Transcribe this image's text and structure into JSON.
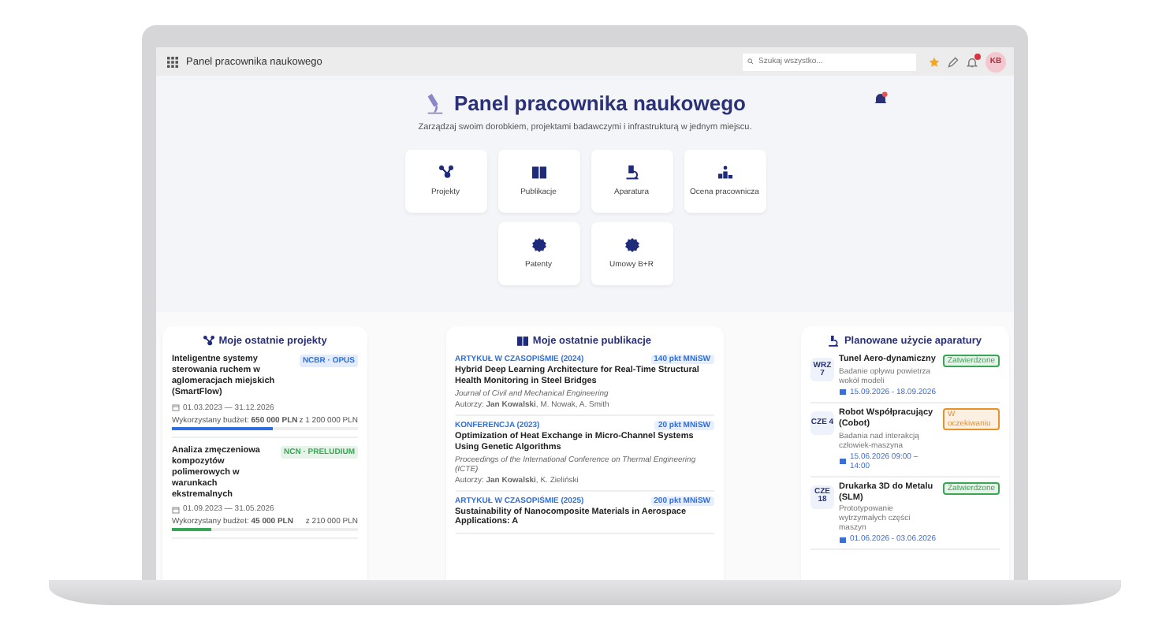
{
  "top_bar": {
    "title": "Panel pracownika naukowego",
    "search": {
      "placeholder": "Szukaj wszystko..."
    },
    "avatar": "KB"
  },
  "hero": {
    "title": "Panel pracownika naukowego",
    "subtitle": "Zarządzaj swoim dorobkiem, projektami badawczymi i infrastrukturą w jednym miejscu."
  },
  "tiles": [
    {
      "label": "Projekty",
      "kind": "network"
    },
    {
      "label": "Publikacje",
      "kind": "book"
    },
    {
      "label": "Aparatura",
      "kind": "microscope"
    },
    {
      "label": "Ocena pracownicza",
      "kind": "podium"
    },
    {
      "label": "Patenty",
      "kind": "seal"
    },
    {
      "label": "Umowy B+R",
      "kind": "seal"
    }
  ],
  "projects": {
    "title": "Moje ostatnie projekty",
    "items": [
      {
        "title": "Inteligentne systemy sterowania ruchem w aglomeracjach miejskich (SmartFlow)",
        "tag": "NCBR · OPUS",
        "color": "#2f6fdc",
        "dates": "01.03.2023 — 31.12.2026",
        "budget": "Wykorzystany budżet: **650 000 PLN**",
        "total": "z 1 200 000 PLN",
        "level": 0.54
      },
      {
        "title": "Analiza zmęczeniowa kompozytów polimerowych w warunkach ekstremalnych",
        "tag": "NCN · PRELUDIUM",
        "color": "#3aa655",
        "dates": "01.09.2023 — 31.05.2026",
        "budget": "Wykorzystany budżet: **45 000 PLN**",
        "total": "z 210 000 PLN",
        "level": 0.21
      }
    ]
  },
  "publications": {
    "title": "Moje ostatnie publikacje",
    "items": [
      {
        "type": "ARTYKUŁ W CZASOPIŚMIE (2024)",
        "points": "140 pkt MNiSW",
        "title": "Hybrid Deep Learning Architecture for Real-Time Structural Health Monitoring in Steel Bridges",
        "venue": "Journal of Civil and Mechanical Engineering",
        "authors": "Autorzy: **Jan Kowalski**, M. Nowak, A. Smith"
      },
      {
        "type": "KONFERENCJA (2023)",
        "points": "20 pkt MNiSW",
        "title": "Optimization of Heat Exchange in Micro-Channel Systems Using Genetic Algorithms",
        "venue": "Proceedings of the International Conference on Thermal Engineering (ICTE)",
        "authors": "Autorzy: **Jan Kowalski**, K. Zieliński"
      },
      {
        "type": "ARTYKUŁ W CZASOPIŚMIE (2025)",
        "points": "200 pkt MNiSW",
        "title": "Sustainability of Nanocomposite Materials in Aerospace Applications: A"
      }
    ]
  },
  "equipment": {
    "title": "Planowane użycie aparatury",
    "items": [
      {
        "day": "WRZ 7",
        "name": "Tunel Aero-dynamiczny",
        "status": "Zatwierdzone",
        "color": "#3aa655",
        "purpose": "Badanie opływu powietrza wokół modeli",
        "dates": "15.09.2026 - 18.09.2026"
      },
      {
        "day": "CZE 4",
        "name": "Robot Współpracujący (Cobot)",
        "status": "W oczekiwaniu",
        "color": "#e8902a",
        "purpose": "Badania nad interakcją człowiek-maszyna",
        "dates": "15.06.2026 09:00 – 14:00"
      },
      {
        "day": "CZE 18",
        "name": "Drukarka 3D do Metalu (SLM)",
        "status": "Zatwierdzone",
        "color": "#3aa655",
        "purpose": "Prototypowanie wytrzymałych części maszyn",
        "dates": "01.06.2026 - 03.06.2026"
      }
    ]
  }
}
